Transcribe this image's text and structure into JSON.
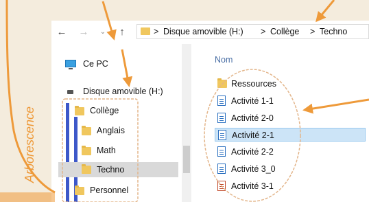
{
  "annotation": {
    "vertical_label": "Arborescence"
  },
  "toolbar": {
    "back_icon": "arrow-left-icon",
    "forward_icon": "arrow-right-icon",
    "dropdown_icon": "chevron-down-icon",
    "up_icon": "arrow-up-icon"
  },
  "address_bar": {
    "segments": [
      "Disque amovible (H:)",
      "Collège",
      "Techno"
    ],
    "separator": ">"
  },
  "nav_pane": {
    "pc": "Ce PC",
    "drive": "Disque amovible (H:)",
    "tree": [
      "Collège",
      "Anglais",
      "Math",
      "Techno",
      "Personnel"
    ]
  },
  "list": {
    "column_header": "Nom",
    "items": [
      "Ressources",
      "Activité 1-1",
      "Activité 2-0",
      "Activité 2-1",
      "Activité 2-2",
      "Activité 3_0",
      "Activité 3-1"
    ]
  },
  "colors": {
    "accent_orange": "#ee9a3a",
    "tree_bar_blue": "#3d58c9",
    "selection": "#cce4f7"
  }
}
